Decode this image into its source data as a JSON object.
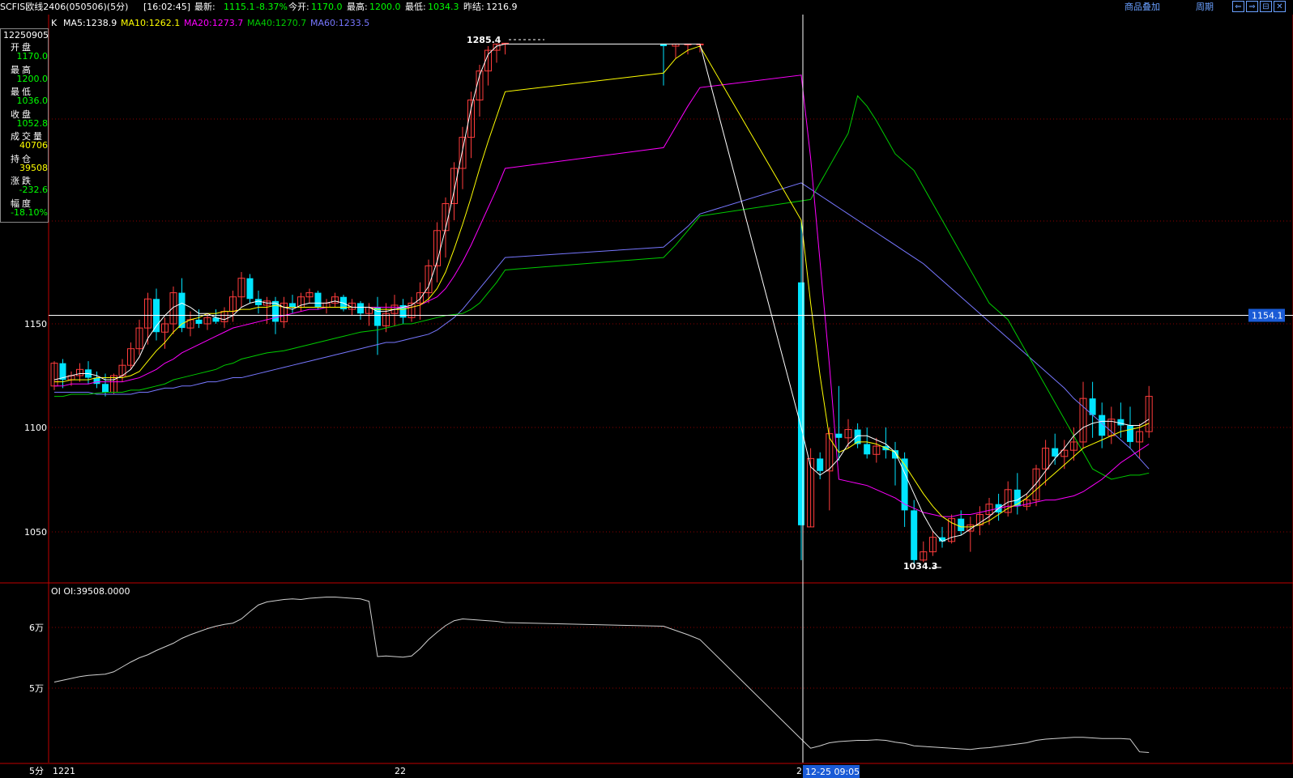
{
  "header": {
    "symbol": "SCFIS欧线2406(050506)(5分)",
    "time": "[16:02:45]",
    "latest_label": "最新:",
    "latest": "1115.1",
    "change_pct": "-8.37%",
    "open_label": "今开:",
    "open": "1170.0",
    "high_label": "最高:",
    "high": "1200.0",
    "low_label": "最低:",
    "low": "1034.3",
    "prev_label": "昨结:",
    "prev_settle": "1216.9",
    "overlay_link": "商品叠加",
    "period_link": "周期"
  },
  "legend": {
    "k": "K",
    "ma5": "MA5:1238.9",
    "ma10": "MA10:1262.1",
    "ma20": "MA20:1273.7",
    "ma40": "MA40:1270.7",
    "ma60": "MA60:1233.5"
  },
  "info_panel": {
    "date": "12250905",
    "rows": [
      {
        "label": "开盘",
        "value": "1170.0",
        "color": "#00ff00"
      },
      {
        "label": "最高",
        "value": "1200.0",
        "color": "#00ff00"
      },
      {
        "label": "最低",
        "value": "1036.0",
        "color": "#00ff00"
      },
      {
        "label": "收盘",
        "value": "1052.8",
        "color": "#00ff00"
      },
      {
        "label": "成交量",
        "value": "40706",
        "color": "#ffff00"
      },
      {
        "label": "持仓",
        "value": "39508",
        "color": "#ffff00"
      },
      {
        "label": "涨跌",
        "value": "-232.6",
        "color": "#00ff00"
      },
      {
        "label": "幅度",
        "value": "-18.10%",
        "color": "#00ff00"
      }
    ]
  },
  "sub_legend": "OI OI:39508.0000",
  "cursor": {
    "price": "1154.1",
    "time": "12-25 09:05"
  },
  "period_label": "5分",
  "colors": {
    "up": "#ff3c3c",
    "down": "#00e4ff",
    "ma5": "#ffffff",
    "ma10": "#ffff00",
    "ma20": "#ff00ff",
    "ma40": "#00cc00",
    "ma60": "#7777ff",
    "oi": "#d0d0d0",
    "grid": "#8b0000"
  },
  "chart_data": {
    "type": "candlestick",
    "y_ticks": [
      "1150",
      "1100",
      "1050"
    ],
    "sub_y_ticks": [
      "6万",
      "5万"
    ],
    "x_labels": [
      "1221",
      "22",
      "2"
    ],
    "annotations": {
      "max": "1285.4",
      "min": "1034.3"
    },
    "candles": [
      [
        1120,
        1132,
        1118,
        1131
      ],
      [
        1131,
        1133,
        1119,
        1123
      ],
      [
        1123,
        1127,
        1120,
        1125
      ],
      [
        1125,
        1131,
        1122,
        1128
      ],
      [
        1128,
        1132,
        1121,
        1124
      ],
      [
        1124,
        1127,
        1119,
        1121
      ],
      [
        1121,
        1126,
        1115,
        1117
      ],
      [
        1117,
        1126,
        1116,
        1125
      ],
      [
        1125,
        1133,
        1122,
        1130
      ],
      [
        1130,
        1141,
        1128,
        1138
      ],
      [
        1138,
        1152,
        1135,
        1148
      ],
      [
        1148,
        1165,
        1140,
        1162
      ],
      [
        1162,
        1167,
        1142,
        1146
      ],
      [
        1146,
        1153,
        1138,
        1150
      ],
      [
        1150,
        1168,
        1145,
        1165
      ],
      [
        1165,
        1172,
        1146,
        1148
      ],
      [
        1148,
        1156,
        1144,
        1152
      ],
      [
        1152,
        1157,
        1148,
        1150
      ],
      [
        1150,
        1155,
        1147,
        1153
      ],
      [
        1153,
        1157,
        1150,
        1151
      ],
      [
        1151,
        1158,
        1148,
        1156
      ],
      [
        1156,
        1166,
        1151,
        1163
      ],
      [
        1163,
        1175,
        1158,
        1172
      ],
      [
        1172,
        1174,
        1160,
        1162
      ],
      [
        1162,
        1166,
        1155,
        1159
      ],
      [
        1159,
        1163,
        1150,
        1161
      ],
      [
        1161,
        1163,
        1145,
        1151
      ],
      [
        1151,
        1163,
        1148,
        1160
      ],
      [
        1160,
        1164,
        1155,
        1158
      ],
      [
        1158,
        1165,
        1156,
        1163
      ],
      [
        1163,
        1167,
        1160,
        1165
      ],
      [
        1165,
        1166,
        1157,
        1158
      ],
      [
        1158,
        1162,
        1155,
        1160
      ],
      [
        1160,
        1165,
        1158,
        1163
      ],
      [
        1163,
        1164,
        1156,
        1157
      ],
      [
        1157,
        1162,
        1154,
        1160
      ],
      [
        1160,
        1161,
        1152,
        1155
      ],
      [
        1155,
        1160,
        1149,
        1158
      ],
      [
        1158,
        1163,
        1135,
        1149
      ],
      [
        1149,
        1160,
        1146,
        1155
      ],
      [
        1155,
        1164,
        1149,
        1159
      ],
      [
        1159,
        1162,
        1150,
        1153
      ],
      [
        1153,
        1163,
        1151,
        1160
      ],
      [
        1160,
        1170,
        1152,
        1165
      ],
      [
        1165,
        1181,
        1160,
        1178
      ],
      [
        1178,
        1199,
        1170,
        1195
      ],
      [
        1195,
        1211,
        1182,
        1208
      ],
      [
        1208,
        1228,
        1200,
        1225
      ],
      [
        1225,
        1245,
        1215,
        1240
      ],
      [
        1240,
        1262,
        1230,
        1258
      ],
      [
        1258,
        1275,
        1250,
        1272
      ],
      [
        1272,
        1284,
        1265,
        1282
      ],
      [
        1282,
        1285,
        1276,
        1285
      ],
      [
        1285,
        1285.4,
        1280,
        1285.4
      ],
      [
        1285,
        1285,
        1265,
        1284
      ],
      [
        1284,
        1285,
        1278,
        1285
      ],
      [
        1285,
        1285,
        1280,
        1285
      ],
      [
        1285,
        1285,
        1281,
        1285
      ],
      [
        1170,
        1200,
        1036,
        1052.8
      ],
      [
        1052,
        1090,
        1052,
        1085
      ],
      [
        1085,
        1088,
        1075,
        1079
      ],
      [
        1079,
        1100,
        1060,
        1097
      ],
      [
        1097,
        1120,
        1084,
        1095
      ],
      [
        1095,
        1104,
        1090,
        1099
      ],
      [
        1099,
        1102,
        1090,
        1092
      ],
      [
        1092,
        1100,
        1085,
        1087
      ],
      [
        1087,
        1095,
        1083,
        1091
      ],
      [
        1091,
        1100,
        1085,
        1089
      ],
      [
        1089,
        1093,
        1072,
        1085
      ],
      [
        1085,
        1088,
        1052,
        1060
      ],
      [
        1060,
        1065,
        1034.3,
        1036
      ],
      [
        1036,
        1045,
        1035,
        1040
      ],
      [
        1040,
        1050,
        1038,
        1047
      ],
      [
        1047,
        1052,
        1042,
        1045
      ],
      [
        1045,
        1058,
        1044,
        1056
      ],
      [
        1056,
        1060,
        1048,
        1050
      ],
      [
        1050,
        1057,
        1040,
        1053
      ],
      [
        1053,
        1062,
        1048,
        1058
      ],
      [
        1058,
        1066,
        1053,
        1063
      ],
      [
        1063,
        1068,
        1055,
        1059
      ],
      [
        1059,
        1074,
        1057,
        1070
      ],
      [
        1070,
        1078,
        1058,
        1062
      ],
      [
        1062,
        1068,
        1060,
        1065
      ],
      [
        1065,
        1082,
        1062,
        1080
      ],
      [
        1080,
        1094,
        1072,
        1090
      ],
      [
        1090,
        1097,
        1082,
        1086
      ],
      [
        1086,
        1094,
        1080,
        1089
      ],
      [
        1089,
        1100,
        1084,
        1093
      ],
      [
        1093,
        1122,
        1090,
        1114
      ],
      [
        1114,
        1122,
        1095,
        1106
      ],
      [
        1106,
        1112,
        1090,
        1096
      ],
      [
        1096,
        1110,
        1092,
        1104
      ],
      [
        1104,
        1112,
        1095,
        1101
      ],
      [
        1101,
        1110,
        1090,
        1093
      ],
      [
        1093,
        1102,
        1085,
        1098
      ],
      [
        1098,
        1120,
        1095,
        1115
      ]
    ],
    "ma5": [
      1123,
      1124,
      1125,
      1126,
      1126,
      1125,
      1123,
      1123,
      1125,
      1128,
      1134,
      1143,
      1149,
      1154,
      1158,
      1160,
      1158,
      1155,
      1155,
      1153,
      1152,
      1154,
      1158,
      1160,
      1161,
      1160,
      1160,
      1158,
      1157,
      1159,
      1160,
      1160,
      1160,
      1161,
      1160,
      1158,
      1158,
      1158,
      1156,
      1156,
      1157,
      1158,
      1159,
      1162,
      1168,
      1180,
      1196,
      1214,
      1234,
      1254,
      1270,
      1280,
      1284,
      1285,
      1285,
      1285,
      1285,
      1285,
      1100,
      1081,
      1077,
      1080,
      1085,
      1092,
      1096,
      1096,
      1094,
      1092,
      1088,
      1078,
      1068,
      1058,
      1050,
      1045,
      1047,
      1048,
      1051,
      1054,
      1057,
      1061,
      1064,
      1065,
      1068,
      1073,
      1079,
      1085,
      1090,
      1096,
      1100,
      1102,
      1103,
      1103,
      1102,
      1101,
      1101,
      1104
    ],
    "ma10": [
      1122,
      1122,
      1123,
      1123,
      1123,
      1124,
      1124,
      1124,
      1124,
      1125,
      1127,
      1132,
      1137,
      1141,
      1146,
      1150,
      1152,
      1153,
      1155,
      1155,
      1156,
      1156,
      1157,
      1157,
      1158,
      1158,
      1159,
      1158,
      1158,
      1158,
      1158,
      1158,
      1158,
      1158,
      1158,
      1158,
      1158,
      1158,
      1157,
      1157,
      1157,
      1157,
      1158,
      1159,
      1162,
      1167,
      1175,
      1186,
      1198,
      1211,
      1225,
      1238,
      1250,
      1262,
      1271,
      1278,
      1282,
      1284,
      1200,
      1160,
      1125,
      1095,
      1088,
      1090,
      1093,
      1093,
      1092,
      1090,
      1088,
      1082,
      1075,
      1068,
      1062,
      1057,
      1054,
      1052,
      1052,
      1053,
      1055,
      1058,
      1061,
      1063,
      1066,
      1070,
      1074,
      1078,
      1082,
      1086,
      1090,
      1092,
      1094,
      1096,
      1098,
      1099,
      1100,
      1102
    ],
    "ma20": [
      1120,
      1120,
      1121,
      1121,
      1121,
      1122,
      1122,
      1122,
      1122,
      1123,
      1124,
      1126,
      1128,
      1131,
      1133,
      1136,
      1138,
      1140,
      1142,
      1144,
      1146,
      1148,
      1149,
      1150,
      1151,
      1152,
      1153,
      1154,
      1155,
      1156,
      1157,
      1157,
      1158,
      1158,
      1158,
      1158,
      1158,
      1158,
      1158,
      1158,
      1158,
      1158,
      1158,
      1159,
      1161,
      1163,
      1167,
      1173,
      1180,
      1188,
      1197,
      1206,
      1215,
      1225,
      1235,
      1245,
      1255,
      1264,
      1270,
      1230,
      1180,
      1130,
      1075,
      1074,
      1073,
      1072,
      1070,
      1068,
      1066,
      1063,
      1061,
      1059,
      1058,
      1057,
      1057,
      1058,
      1058,
      1059,
      1060,
      1061,
      1062,
      1062,
      1063,
      1064,
      1065,
      1065,
      1066,
      1067,
      1069,
      1072,
      1075,
      1079,
      1083,
      1086,
      1089,
      1092
    ],
    "ma40": [
      1115,
      1115,
      1116,
      1116,
      1116,
      1117,
      1117,
      1117,
      1118,
      1118,
      1119,
      1120,
      1121,
      1123,
      1124,
      1126,
      1127,
      1128,
      1130,
      1131,
      1133,
      1134,
      1135,
      1136,
      1137,
      1138,
      1139,
      1140,
      1141,
      1142,
      1143,
      1144,
      1145,
      1146,
      1147,
      1148,
      1149,
      1150,
      1150,
      1151,
      1152,
      1153,
      1154,
      1155,
      1157,
      1160,
      1165,
      1170,
      1176,
      1182,
      1188,
      1195,
      1202,
      1210,
      1218,
      1226,
      1234,
      1242,
      1260,
      1255,
      1248,
      1240,
      1232,
      1224,
      1216,
      1208,
      1200,
      1192,
      1184,
      1176,
      1168,
      1160,
      1152,
      1144,
      1136,
      1128,
      1120,
      1112,
      1104,
      1096,
      1088,
      1080,
      1075,
      1076,
      1077,
      1077,
      1078
    ],
    "ma60": [
      1117,
      1117,
      1117,
      1117,
      1117,
      1116,
      1116,
      1116,
      1116,
      1116,
      1117,
      1117,
      1118,
      1119,
      1119,
      1120,
      1120,
      1121,
      1122,
      1122,
      1123,
      1124,
      1124,
      1125,
      1126,
      1127,
      1128,
      1129,
      1130,
      1131,
      1132,
      1133,
      1134,
      1135,
      1136,
      1137,
      1138,
      1139,
      1140,
      1141,
      1141,
      1142,
      1143,
      1144,
      1145,
      1147,
      1150,
      1153,
      1157,
      1162,
      1167,
      1172,
      1177,
      1182,
      1187,
      1192,
      1197,
      1203,
      1218,
      1215,
      1212,
      1209,
      1206,
      1203,
      1200,
      1197,
      1194,
      1191,
      1188,
      1185,
      1182,
      1179,
      1175,
      1171,
      1167,
      1163,
      1159,
      1155,
      1151,
      1147,
      1143,
      1139,
      1135,
      1131,
      1127,
      1123,
      1119,
      1114,
      1110,
      1106,
      1102,
      1098,
      1094,
      1090,
      1085,
      1080
    ],
    "oi": [
      51000,
      51300,
      51600,
      51900,
      52100,
      52200,
      52300,
      52700,
      53500,
      54300,
      55000,
      55500,
      56200,
      56800,
      57400,
      58200,
      58800,
      59300,
      59800,
      60200,
      60500,
      60700,
      61400,
      62600,
      63700,
      64200,
      64400,
      64600,
      64700,
      64600,
      64800,
      64900,
      65000,
      65000,
      64900,
      64800,
      64700,
      64300,
      55200,
      55300,
      55200,
      55100,
      55300,
      56500,
      58000,
      59200,
      60300,
      61100,
      61400,
      61300,
      61200,
      61100,
      61000,
      60800,
      60200,
      59500,
      58800,
      58000,
      41600,
      40100,
      40500,
      41000,
      41200,
      41300,
      41400,
      41400,
      41500,
      41400,
      41100,
      40900,
      40500,
      40400,
      40300,
      40200,
      40100,
      40000,
      39900,
      40100,
      40200,
      40400,
      40600,
      40800,
      41000,
      41400,
      41600,
      41700,
      41800,
      41900,
      41900,
      41800,
      41700,
      41700,
      41700,
      41600,
      39508,
      39400
    ]
  }
}
